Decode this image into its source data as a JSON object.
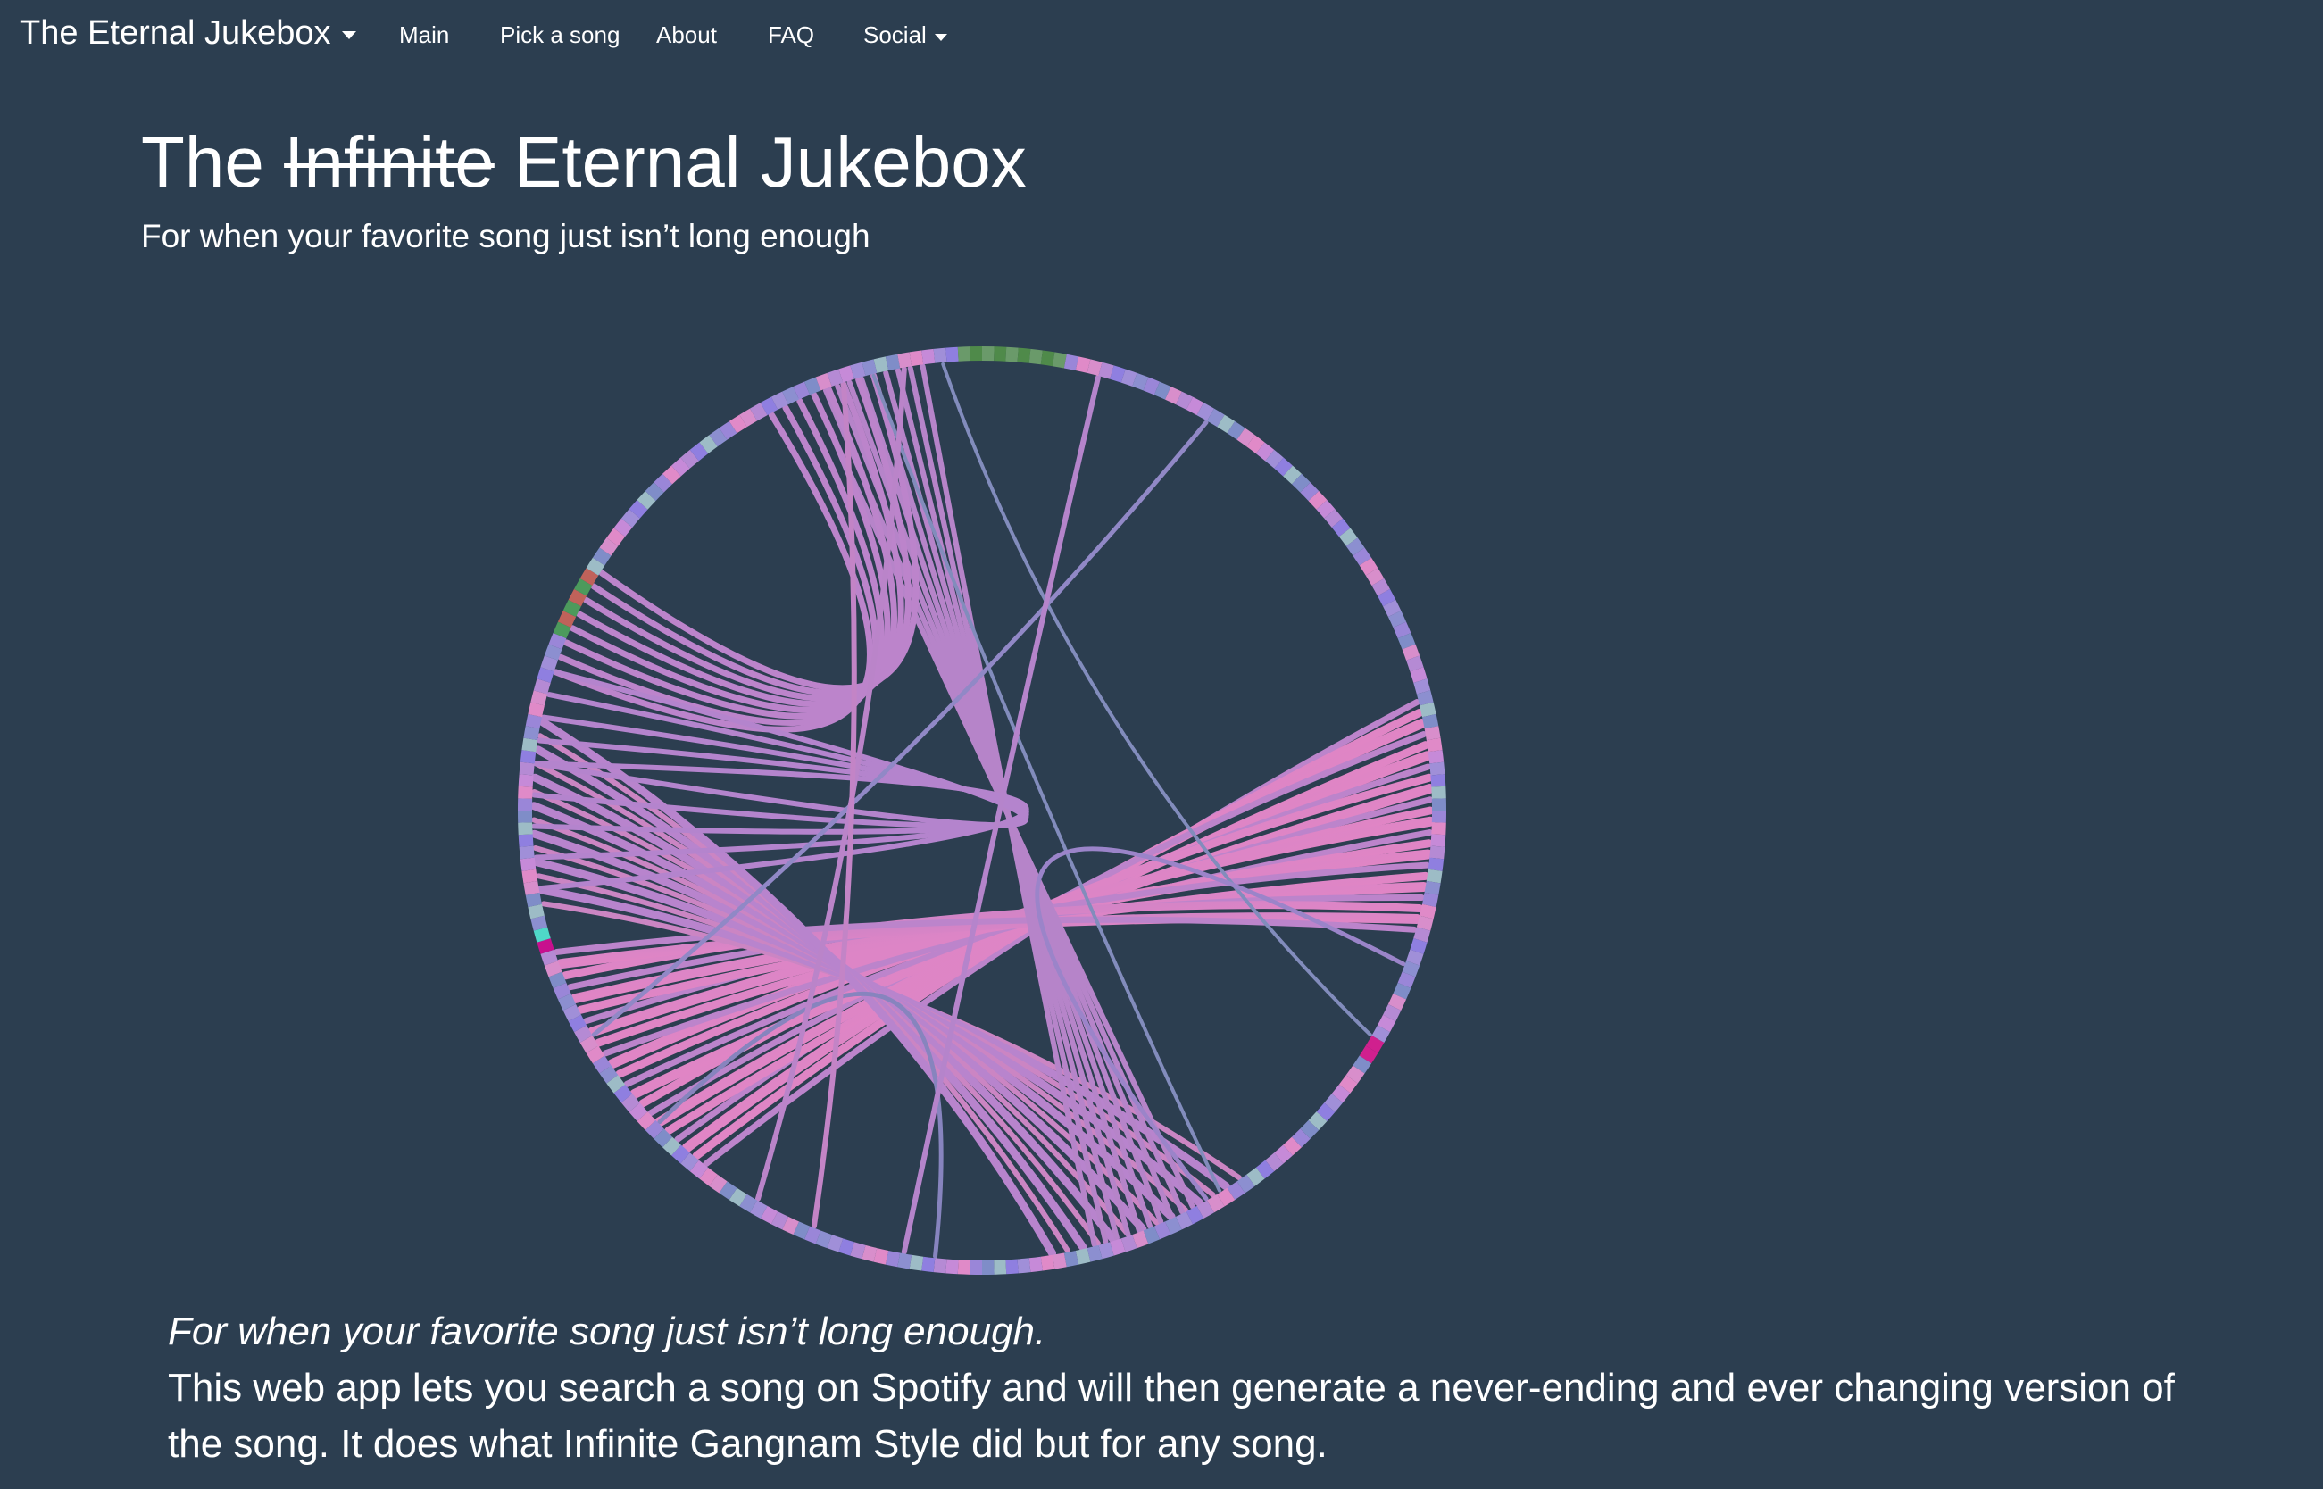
{
  "nav": {
    "brand": "The Eternal Jukebox",
    "items": [
      {
        "label": "Main"
      },
      {
        "label": "Pick a song"
      },
      {
        "label": "About"
      },
      {
        "label": "FAQ"
      },
      {
        "label": "Social"
      }
    ]
  },
  "hero": {
    "title_prefix": "The",
    "title_struck": "Infinite",
    "title_suffix": "Eternal Jukebox",
    "subtitle": "For when your favorite song just isn’t long enough"
  },
  "description": {
    "lead": "For when your favorite song just isn’t long enough.",
    "body": "This web app lets you search a song on Spotify and will then generate a never-ending and ever changing version of the song. It does what Infinite Gangnam Style did but for any song."
  },
  "colors": {
    "background": "#2c3e50",
    "text": "#ffffff",
    "arc_pink": "#e88fd0",
    "arc_violet": "#b288d8",
    "arc_blue": "#8b8fc8"
  }
}
